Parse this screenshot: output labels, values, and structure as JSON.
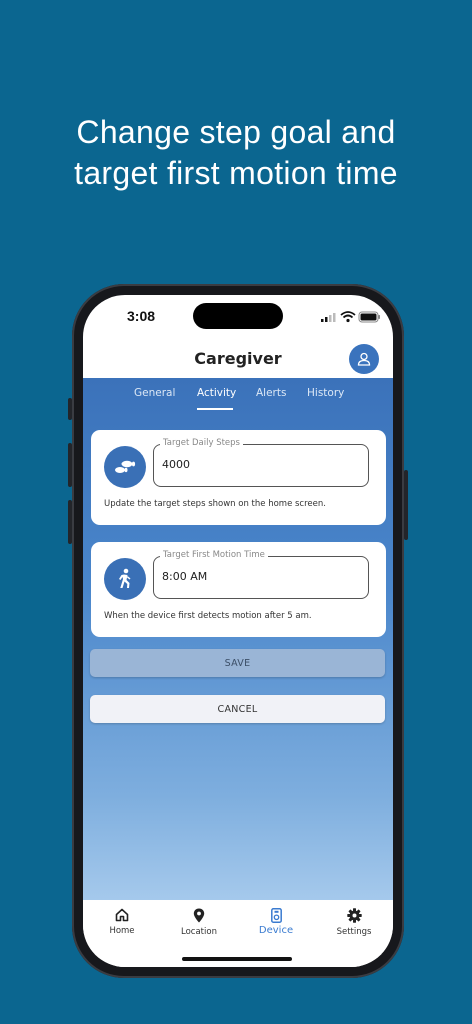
{
  "headline": {
    "line1": "Change step goal and",
    "line2": "target first motion time"
  },
  "statusbar": {
    "time": "3:08",
    "icons": [
      "signal-icon",
      "wifi-icon",
      "battery-icon"
    ]
  },
  "appbar": {
    "title": "Caregiver",
    "profile_icon": "user-icon"
  },
  "tabs": [
    {
      "label": "General",
      "active": false
    },
    {
      "label": "Activity",
      "active": true
    },
    {
      "label": "Alerts",
      "active": false
    },
    {
      "label": "History",
      "active": false
    }
  ],
  "steps_card": {
    "icon": "footsteps-icon",
    "label": "Target Daily Steps",
    "value": "4000",
    "helper": "Update the target steps shown on the home screen."
  },
  "motion_card": {
    "icon": "walking-person-icon",
    "label": "Target First Motion Time",
    "value": "8:00 AM",
    "helper": "When the device first detects motion after 5 am."
  },
  "actions": {
    "save": "SAVE",
    "cancel": "CANCEL"
  },
  "bottom_nav": [
    {
      "label": "Home",
      "icon": "home-icon",
      "active": false
    },
    {
      "label": "Location",
      "icon": "location-pin-icon",
      "active": false
    },
    {
      "label": "Device",
      "icon": "device-icon",
      "active": true
    },
    {
      "label": "Settings",
      "icon": "gear-icon",
      "active": false
    }
  ],
  "colors": {
    "background": "#0b6690",
    "accent": "#3a73bd",
    "active_nav": "#3a7bd0"
  }
}
